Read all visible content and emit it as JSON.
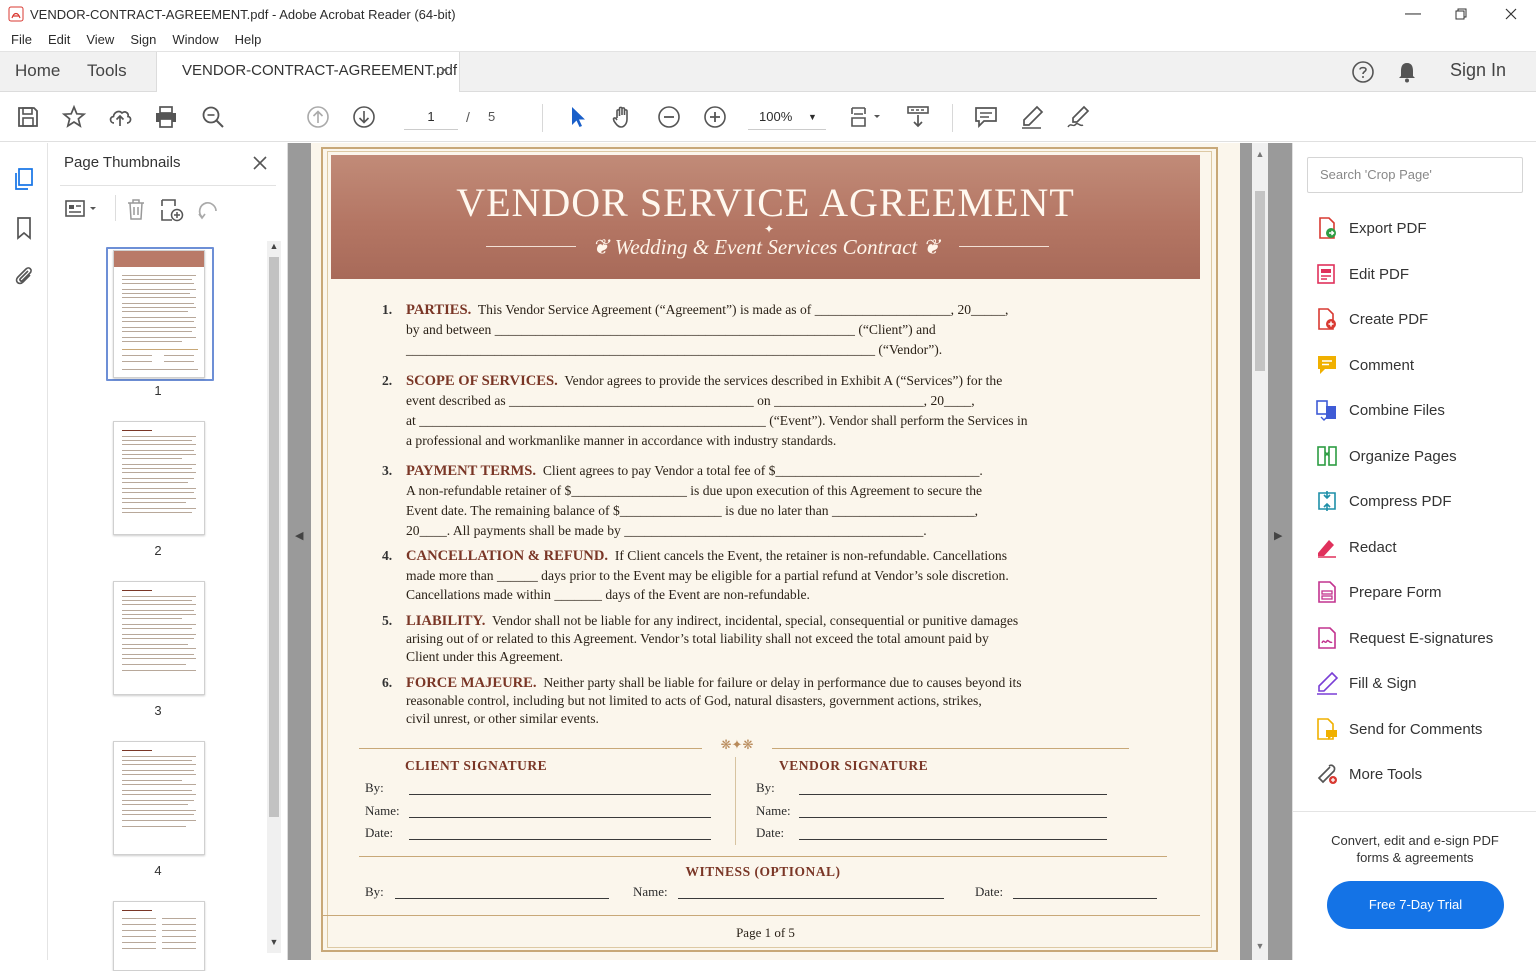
{
  "window": {
    "title": "VENDOR-CONTRACT-AGREEMENT.pdf - Adobe Acrobat Reader (64-bit)",
    "controls": [
      "minimize",
      "restore",
      "close"
    ]
  },
  "menu": [
    "File",
    "Edit",
    "View",
    "Sign",
    "Window",
    "Help"
  ],
  "tabs": {
    "home": "Home",
    "tools": "Tools",
    "document": "VENDOR-CONTRACT-AGREEMENT.pdf",
    "close": "×"
  },
  "header_right": {
    "sign_in": "Sign In"
  },
  "toolbar": {
    "page_current": "1",
    "page_sep": "/",
    "page_total": "5",
    "zoom": "100%"
  },
  "thumbnails": {
    "title": "Page Thumbnails",
    "pages": [
      "1",
      "2",
      "3",
      "4"
    ]
  },
  "document": {
    "title": "VENDOR SERVICE AGREEMENT",
    "subtitle": "Wedding & Event Services Contract",
    "clauses": [
      {
        "num": "1.",
        "heading": "PARTIES.",
        "lines": [
          "This Vendor Service Agreement (“Agreement”) is made as of ____________________, 20_____,",
          "by and between _____________________________________________________ (“Client”) and",
          "_____________________________________________________________________ (“Vendor”)."
        ]
      },
      {
        "num": "2.",
        "heading": "SCOPE OF SERVICES.",
        "lines": [
          "Vendor agrees to provide the services described in Exhibit A (“Services”) for the",
          "event described as ____________________________________ on ______________________, 20____,",
          "at ___________________________________________________ (“Event”). Vendor shall perform the Services in",
          "a professional and workmanlike manner in accordance with industry standards."
        ]
      },
      {
        "num": "3.",
        "heading": "PAYMENT TERMS.",
        "lines": [
          "Client agrees to pay Vendor a total fee of $______________________________.",
          "A non-refundable retainer of $_________________ is due upon execution of this Agreement to secure the",
          "Event date. The remaining balance of $_______________ is due no later than _____________________,",
          "20____. All payments shall be made by ____________________________________________."
        ]
      },
      {
        "num": "4.",
        "heading": "CANCELLATION & REFUND.",
        "lines": [
          "If Client cancels the Event, the retainer is non-refundable. Cancellations",
          "made more than ______ days prior to the Event may be eligible for a partial refund at Vendor’s sole discretion.",
          "Cancellations made within _______ days of the Event are non-refundable."
        ]
      },
      {
        "num": "5.",
        "heading": "LIABILITY.",
        "lines": [
          "Vendor shall not be liable for any indirect, incidental, special, consequential or punitive damages",
          "arising out of or related to this Agreement. Vendor’s total liability shall not exceed the total amount paid by",
          "Client under this Agreement."
        ]
      },
      {
        "num": "6.",
        "heading": "FORCE MAJEURE.",
        "lines": [
          "Neither party shall be liable for failure or delay in performance due to causes beyond its",
          "reasonable control, including but not limited to acts of God, natural disasters, government actions, strikes,",
          "civil unrest, or other similar events."
        ]
      }
    ],
    "client_sig": {
      "title": "CLIENT SIGNATURE",
      "by": "By:",
      "name": "Name:",
      "date": "Date:"
    },
    "vendor_sig": {
      "title": "VENDOR SIGNATURE",
      "by": "By:",
      "name": "Name:",
      "date": "Date:"
    },
    "witness": {
      "title": "WITNESS (OPTIONAL)",
      "by": "By:",
      "name": "Name:",
      "date": "Date:"
    },
    "footer": "Page 1 of 5"
  },
  "right_panel": {
    "search_placeholder": "Search 'Crop Page'",
    "tools": [
      {
        "label": "Export PDF",
        "icon": "export-pdf-icon",
        "color": "#d93a32"
      },
      {
        "label": "Edit PDF",
        "icon": "edit-pdf-icon",
        "color": "#e0315c"
      },
      {
        "label": "Create PDF",
        "icon": "create-pdf-icon",
        "color": "#d93a32"
      },
      {
        "label": "Comment",
        "icon": "comment-icon",
        "color": "#f0b000"
      },
      {
        "label": "Combine Files",
        "icon": "combine-files-icon",
        "color": "#3f5bd6"
      },
      {
        "label": "Organize Pages",
        "icon": "organize-pages-icon",
        "color": "#2d9d43"
      },
      {
        "label": "Compress PDF",
        "icon": "compress-pdf-icon",
        "color": "#1e8fa8"
      },
      {
        "label": "Redact",
        "icon": "redact-icon",
        "color": "#e0315c"
      },
      {
        "label": "Prepare Form",
        "icon": "prepare-form-icon",
        "color": "#c2338f"
      },
      {
        "label": "Request E-signatures",
        "icon": "request-esignatures-icon",
        "color": "#c2338f"
      },
      {
        "label": "Fill & Sign",
        "icon": "fill-sign-icon",
        "color": "#7a3fd6"
      },
      {
        "label": "Send for Comments",
        "icon": "send-for-comments-icon",
        "color": "#f0b000"
      },
      {
        "label": "More Tools",
        "icon": "more-tools-icon",
        "color": "#555555"
      }
    ],
    "promo_text": "Convert, edit and e-sign PDF forms & agreements",
    "trial_button": "Free 7-Day Trial"
  },
  "colors": {
    "accent_blue": "#1473e6",
    "banner": "#b97a68",
    "heading_brown": "#7a3626",
    "gold": "#c8a878"
  }
}
